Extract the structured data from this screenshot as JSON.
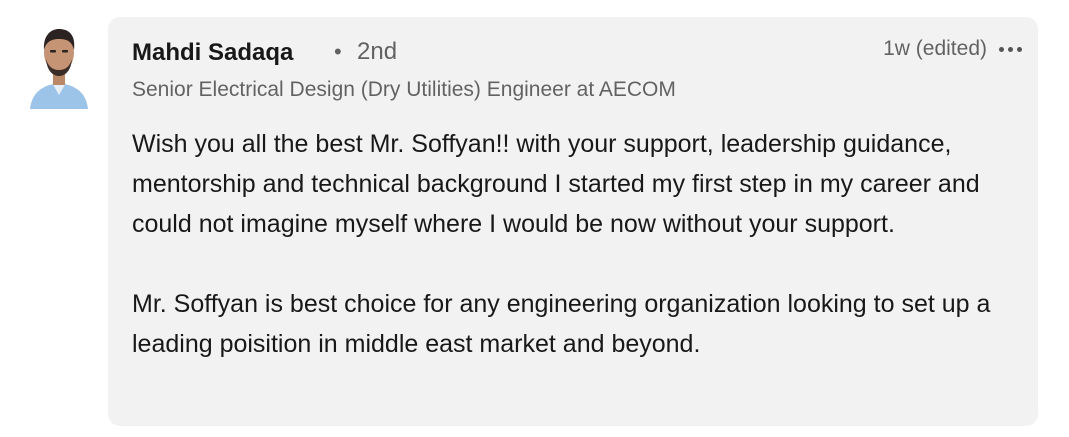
{
  "comment": {
    "author": {
      "name": "Mahdi Sadaqa",
      "degree_separator": "•",
      "degree": "2nd",
      "headline": "Senior Electrical Design (Dry Utilities) Engineer at AECOM",
      "avatar_icon": "profile-photo"
    },
    "time": "1w (edited)",
    "more_icon": "ellipsis-icon",
    "paragraphs": [
      "Wish you all the best Mr. Soffyan!! with your support, leadership guidance, mentorship and technical background I started my first step in my career and could not imagine myself where I would be now without your support.",
      "Mr. Soffyan is best choice for any engineering organization looking to set up a leading poisition in middle east market and beyond."
    ],
    "colors": {
      "bubble_background": "#f2f2f2",
      "primary_text": "#1f1f1f",
      "secondary_text": "#666666"
    }
  }
}
